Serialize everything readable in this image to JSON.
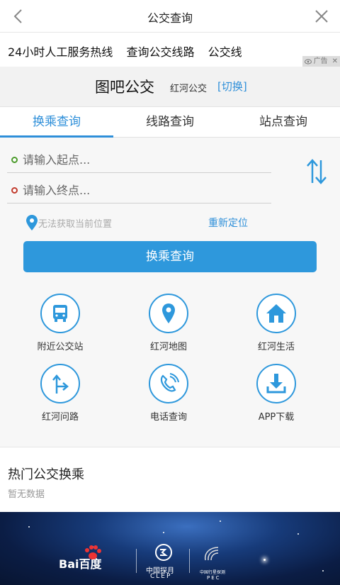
{
  "header": {
    "title": "公交查询"
  },
  "adbar": {
    "links": [
      "24小时人工服务热线",
      "查询公交线路",
      "公交线"
    ],
    "ad_label": "广告"
  },
  "brand": {
    "name": "图吧公交",
    "city": "红河公交",
    "switch_label": "[切换]"
  },
  "tabs": [
    {
      "label": "换乘查询",
      "active": true
    },
    {
      "label": "线路查询",
      "active": false
    },
    {
      "label": "站点查询",
      "active": false
    }
  ],
  "form": {
    "start_placeholder": "请输入起点...",
    "end_placeholder": "请输入终点...",
    "location_message": "无法获取当前位置",
    "relocate_label": "重新定位",
    "search_button": "换乘查询"
  },
  "grid": [
    {
      "label": "附近公交站",
      "icon": "bus-icon"
    },
    {
      "label": "红河地图",
      "icon": "map-pin-icon"
    },
    {
      "label": "红河生活",
      "icon": "home-icon"
    },
    {
      "label": "红河问路",
      "icon": "direction-sign-icon"
    },
    {
      "label": "电话查询",
      "icon": "phone-icon"
    },
    {
      "label": "APP下载",
      "icon": "download-icon"
    }
  ],
  "hot": {
    "title": "热门公交换乘",
    "empty_text": "暂无数据"
  },
  "banner": {
    "baidu_text": "Bai百度",
    "clep_cn": "中国探月",
    "clep_en": "CLEP",
    "pec_cn": "中国行星探测",
    "pec_en": "PEC"
  },
  "colors": {
    "accent": "#2e98dc",
    "start_dot": "#4a9a2a",
    "end_dot": "#c0392b"
  }
}
